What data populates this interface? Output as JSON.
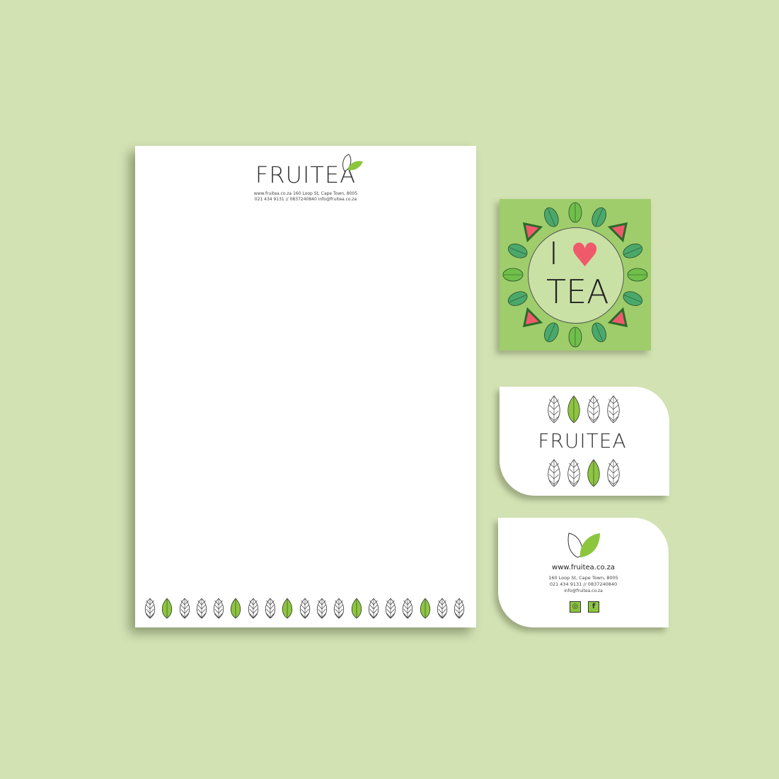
{
  "brand": "FRUITEA",
  "letterhead": {
    "line1": "www.fruitea.co.za    160 Loop St, Cape Town, 8005",
    "line2": "021 434 9131 // 0837240840    info@fruitea.co.za",
    "leaf_pattern": [
      "outline",
      "green",
      "outline",
      "outline",
      "outline",
      "green",
      "outline",
      "outline",
      "green",
      "outline",
      "outline",
      "outline",
      "green",
      "outline",
      "outline",
      "outline",
      "green",
      "outline",
      "outline"
    ]
  },
  "square_card": {
    "line1": "I",
    "heart": "♥",
    "line2": "TEA"
  },
  "business_card_back": {
    "website": "www.fruitea.co.za",
    "address": "160 Loop St, Cape Town, 8005",
    "phone": "021 434 9131 // 0837240840",
    "email": "info@fruitea.co.za",
    "social": [
      "instagram-icon",
      "facebook-icon"
    ],
    "facebook_glyph": "f"
  },
  "colors": {
    "background": "#d3e2b3",
    "green": "#8cc63f",
    "card_green": "#9fcd6b",
    "watermelon": "#ef5a6b"
  }
}
